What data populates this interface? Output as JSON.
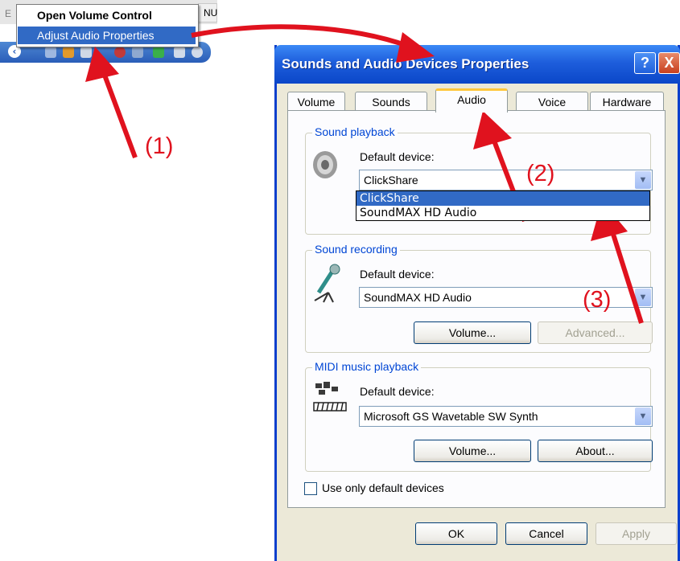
{
  "taskbar": {
    "left_fragment": "E",
    "right_fragment": "NU",
    "context_menu": {
      "items": [
        {
          "label": "Open Volume Control"
        },
        {
          "label": "Adjust Audio Properties"
        }
      ]
    }
  },
  "annotations": {
    "labels": [
      "(1)",
      "(2)",
      "(3)"
    ],
    "color": "#e0121e"
  },
  "dialog": {
    "title": "Sounds and Audio Devices Properties",
    "help_glyph": "?",
    "close_glyph": "X",
    "tabs": [
      {
        "label": "Volume"
      },
      {
        "label": "Sounds"
      },
      {
        "label": "Audio",
        "active": true
      },
      {
        "label": "Voice"
      },
      {
        "label": "Hardware"
      }
    ],
    "playback": {
      "title": "Sound playback",
      "default_label": "Default device:",
      "selected": "ClickShare",
      "options": [
        "ClickShare",
        "SoundMAX HD Audio"
      ]
    },
    "recording": {
      "title": "Sound recording",
      "default_label": "Default device:",
      "selected": "SoundMAX HD Audio",
      "volume_button": "Volume...",
      "advanced_button": "Advanced..."
    },
    "midi": {
      "title": "MIDI music playback",
      "default_label": "Default device:",
      "selected": "Microsoft GS Wavetable SW Synth",
      "volume_button": "Volume...",
      "about_button": "About..."
    },
    "use_default_only": "Use only default devices",
    "ok_button": "OK",
    "cancel_button": "Cancel",
    "apply_button": "Apply"
  }
}
